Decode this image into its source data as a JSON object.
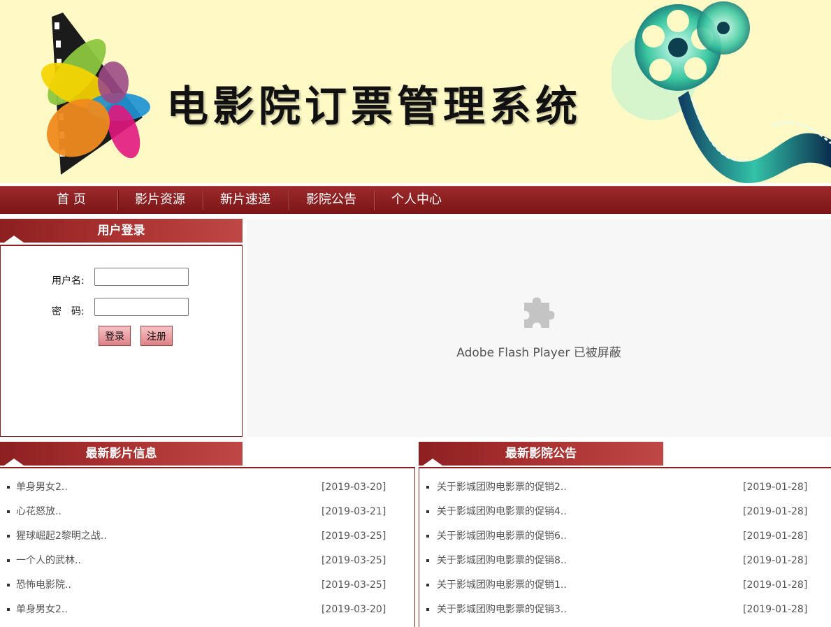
{
  "header": {
    "site_title": "电影院订票管理系统"
  },
  "nav": {
    "items": [
      {
        "label": "首 页"
      },
      {
        "label": "影片资源"
      },
      {
        "label": "新片速递"
      },
      {
        "label": "影院公告"
      },
      {
        "label": "个人中心"
      }
    ]
  },
  "login": {
    "heading": "用户登录",
    "username_label": "用户名:",
    "username_value": "",
    "password_label": "密　码:",
    "password_value": "",
    "login_button": "登录",
    "register_button": "注册"
  },
  "flash": {
    "message": "Adobe Flash Player 已被屏蔽"
  },
  "movies": {
    "heading": "最新影片信息",
    "items": [
      {
        "title": "单身男女2..",
        "date": "[2019-03-20]"
      },
      {
        "title": "心花怒放..",
        "date": "[2019-03-21]"
      },
      {
        "title": "猩球崛起2黎明之战..",
        "date": "[2019-03-25]"
      },
      {
        "title": "一个人的武林..",
        "date": "[2019-03-25]"
      },
      {
        "title": "恐怖电影院..",
        "date": "[2019-03-25]"
      },
      {
        "title": "单身男女2..",
        "date": "[2019-03-20]"
      }
    ]
  },
  "notices": {
    "heading": "最新影院公告",
    "items": [
      {
        "title": "关于影城团购电影票的促销2..",
        "date": "[2019-01-28]"
      },
      {
        "title": "关于影城团购电影票的促销4..",
        "date": "[2019-01-28]"
      },
      {
        "title": "关于影城团购电影票的促销6..",
        "date": "[2019-01-28]"
      },
      {
        "title": "关于影城团购电影票的促销8..",
        "date": "[2019-01-28]"
      },
      {
        "title": "关于影城团购电影票的促销1..",
        "date": "[2019-01-28]"
      },
      {
        "title": "关于影城团购电影票的促销3..",
        "date": "[2019-01-28]"
      }
    ]
  },
  "colors": {
    "banner_bg": "#fef9c5",
    "nav_bg": "#8b1e20",
    "accent": "#a8302f",
    "flash_bg": "#f7f7f7"
  },
  "icons": {
    "logo": "film-strip-flower-logo-icon",
    "reel": "film-reel-icon",
    "plugin": "puzzle-piece-icon"
  }
}
